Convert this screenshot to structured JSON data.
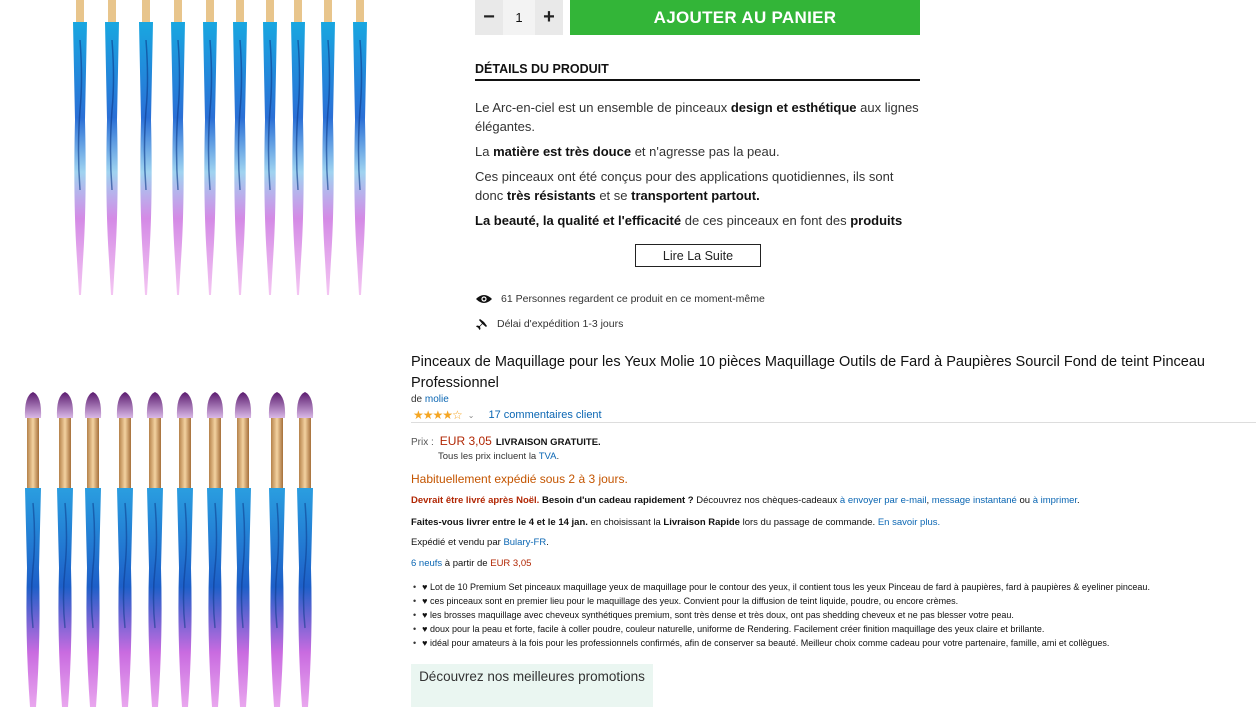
{
  "shop": {
    "qty_minus": "−",
    "qty_value": "1",
    "qty_plus": "+",
    "add_to_cart": "AJOUTER AU PANIER",
    "details_title": "DÉTAILS DU PRODUIT",
    "read_more": "Lire La Suite",
    "watching": "61 Personnes regardent ce produit en ce moment-même",
    "delivery_delay": "Délai d'expédition 1-3 jours",
    "accent_color": "#33b538"
  },
  "description": {
    "p1_a": "Le Arc-en-ciel est un ensemble de pinceaux ",
    "p1_b": "design et esthétique",
    "p1_c": " aux lignes élégantes.",
    "p2_a": "La ",
    "p2_b": "matière est très douce",
    "p2_c": " et n'agresse pas la peau.",
    "p3_a": "Ces pinceaux ont été conçus pour des applications quotidiennes, ils sont donc ",
    "p3_b": "très résistants",
    "p3_c": " et se ",
    "p3_d": "transportent partout.",
    "p4_a": "La beauté, la qualité et l'efficacité",
    "p4_b": " de ces pinceaux en font des ",
    "p4_c": "produits"
  },
  "amazon": {
    "title": "Pinceaux de Maquillage pour les Yeux Molie 10 pièces Maquillage Outils de Fard à Paupières Sourcil Fond de teint Pinceau Professionnel",
    "by_label": "de",
    "brand": "molie",
    "stars": "★★★★☆",
    "rating_chevron": "⌄",
    "reviews": "17 commentaires client",
    "price_label": "Prix :",
    "price": "EUR 3,05",
    "free_shipping": "LIVRAISON GRATUITE.",
    "tva_a": "Tous les prix incluent la ",
    "tva_b": "TVA",
    "tva_c": ".",
    "shipping_time": "Habituellement expédié sous 2 à 3 jours.",
    "deliver_red": "Devrait être livré après Noël.",
    "deliver_bold": " Besoin d'un cadeau rapidement ?",
    "deliver_rest": " Découvrez nos chèques-cadeaux ",
    "deliver_link1": "à envoyer par e-mail",
    "deliver_sep": ", ",
    "deliver_link2": "message instantané",
    "deliver_ou": " ou ",
    "deliver_link3": "à imprimer",
    "deliver_end": ".",
    "fast_a": "Faites-vous livrer entre le 4 et le 14 jan.",
    "fast_b": " en choisissant la ",
    "fast_c": "Livraison Rapide",
    "fast_d": " lors du passage de commande. ",
    "fast_link": "En savoir plus.",
    "sold_a": "Expédié et vendu par ",
    "sold_link": "Bulary-FR",
    "sold_end": ".",
    "new_link": "6 neufs",
    "new_mid": " à partir de ",
    "new_price": "EUR 3,05",
    "bullets": [
      "♥ Lot de 10 Premium Set pinceaux maquillage yeux de maquillage pour le contour des yeux, il contient tous les yeux Pinceau de fard à paupières, fard à paupières & eyeliner pinceau.",
      "♥ ces pinceaux sont en premier lieu pour le maquillage des yeux. Convient pour la diffusion de teint liquide, poudre, ou encore crèmes.",
      "♥ les brosses maquillage avec cheveux synthétiques premium, sont très dense et très doux, ont pas shedding cheveux et ne pas blesser votre peau.",
      "♥ doux pour la peau et forte, facile à coller poudre, couleur naturelle, uniforme de Rendering. Facilement créer finition maquillage des yeux claire et brillante.",
      "♥ idéal pour amateurs à la fois pour les professionnels confirmés, afin de conserver sa beauté. Meilleur choix comme cadeau pour votre partenaire, famille, ami et collègues."
    ],
    "promo": "Découvrez nos meilleures promotions"
  }
}
